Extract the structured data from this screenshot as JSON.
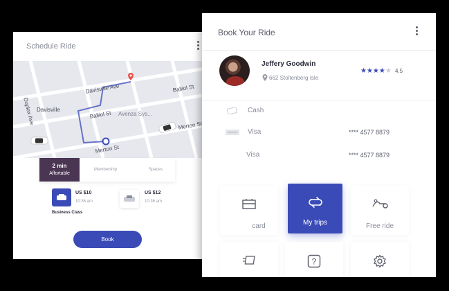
{
  "schedule": {
    "title": "Schedule Ride",
    "map": {
      "streets": [
        "Duplex Ave",
        "Davisville Ave",
        "Balliol St",
        "Balliol St",
        "Davisville",
        "Avenza Sys...",
        "Merton St",
        "Merton St"
      ]
    },
    "tabs": {
      "active_top": "2 min",
      "active_bottom": "Affortable",
      "membership": "Membership",
      "spaces": "Spaces"
    },
    "options": [
      {
        "price": "US $10",
        "time": "10:36 am",
        "class": "Business Class"
      },
      {
        "price": "US $12",
        "time": "10:36 am"
      }
    ],
    "book_label": "Book"
  },
  "booking": {
    "title": "Book Your Ride",
    "user": {
      "name": "Jeffery Goodwin",
      "address": "662 Stoltenberg Isle",
      "rating": "4.5",
      "stars_filled": 4
    },
    "payments": [
      {
        "label": "Cash",
        "number": ""
      },
      {
        "label": "Visa",
        "number": "**** 4577 8879"
      },
      {
        "label": "Visa",
        "number": "**** 4577 8879"
      }
    ],
    "tiles": [
      {
        "label": "card",
        "icon": "card-icon"
      },
      {
        "label": "My trips",
        "icon": "trips-icon"
      },
      {
        "label": "Free ride",
        "icon": "free-ride-icon"
      },
      {
        "label": "",
        "icon": "promo-icon"
      },
      {
        "label": "",
        "icon": "help-icon"
      },
      {
        "label": "",
        "icon": "gear-icon"
      }
    ]
  },
  "colors": {
    "accent": "#3a4bb7",
    "active_tab": "#4a3553",
    "map_bg": "#e6e8ee",
    "pin": "#e9544f"
  }
}
